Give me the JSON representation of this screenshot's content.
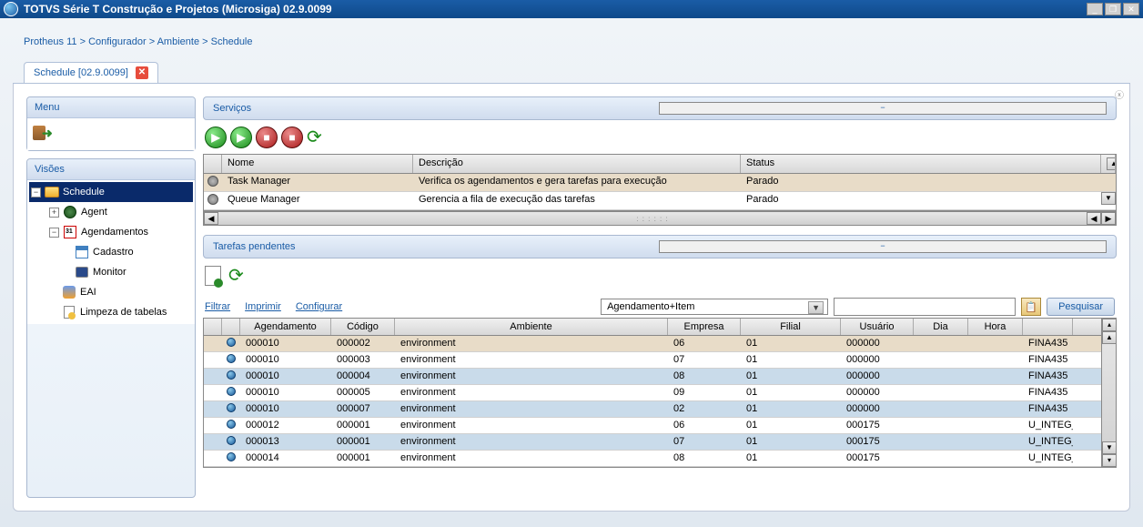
{
  "titlebar": {
    "title": "TOTVS Série T Construção e Projetos (Microsiga) 02.9.0099"
  },
  "breadcrumb": {
    "p1": "Protheus 11",
    "p2": "Configurador",
    "p3": "Ambiente",
    "p4": "Schedule"
  },
  "tab": {
    "label": "Schedule [02.9.0099]"
  },
  "menu": {
    "header": "Menu"
  },
  "visoes": {
    "header": "Visões",
    "tree": {
      "schedule": "Schedule",
      "agent": "Agent",
      "agendamentos": "Agendamentos",
      "cadastro": "Cadastro",
      "monitor": "Monitor",
      "eai": "EAI",
      "limpeza": "Limpeza de tabelas"
    }
  },
  "servicos": {
    "header": "Serviços",
    "cols": {
      "nome": "Nome",
      "desc": "Descrição",
      "status": "Status"
    },
    "rows": [
      {
        "nome": "Task Manager",
        "desc": "Verifica os agendamentos e gera tarefas para execução",
        "status": "Parado"
      },
      {
        "nome": "Queue Manager",
        "desc": "Gerencia a fila de execução das tarefas",
        "status": "Parado"
      }
    ]
  },
  "tarefas": {
    "header": "Tarefas pendentes",
    "links": {
      "filtrar": "Filtrar",
      "imprimir": "Imprimir",
      "configurar": "Configurar"
    },
    "combo": "Agendamento+Item",
    "search_btn": "Pesquisar",
    "cols": {
      "agend": "Agendamento",
      "cod": "Código",
      "amb": "Ambiente",
      "emp": "Empresa",
      "fil": "Filial",
      "usr": "Usuário",
      "dia": "Dia",
      "hora": "Hora"
    },
    "rows": [
      {
        "agend": "000010",
        "cod": "000002",
        "amb": "environment",
        "emp": "06",
        "fil": "01",
        "usr": "000000",
        "dia": "",
        "hora": "",
        "rot": "FINA435"
      },
      {
        "agend": "000010",
        "cod": "000003",
        "amb": "environment",
        "emp": "07",
        "fil": "01",
        "usr": "000000",
        "dia": "",
        "hora": "",
        "rot": "FINA435"
      },
      {
        "agend": "000010",
        "cod": "000004",
        "amb": "environment",
        "emp": "08",
        "fil": "01",
        "usr": "000000",
        "dia": "",
        "hora": "",
        "rot": "FINA435"
      },
      {
        "agend": "000010",
        "cod": "000005",
        "amb": "environment",
        "emp": "09",
        "fil": "01",
        "usr": "000000",
        "dia": "",
        "hora": "",
        "rot": "FINA435"
      },
      {
        "agend": "000010",
        "cod": "000007",
        "amb": "environment",
        "emp": "02",
        "fil": "01",
        "usr": "000000",
        "dia": "",
        "hora": "",
        "rot": "FINA435"
      },
      {
        "agend": "000012",
        "cod": "000001",
        "amb": "environment",
        "emp": "06",
        "fil": "01",
        "usr": "000175",
        "dia": "",
        "hora": "",
        "rot": "U_INTEG_"
      },
      {
        "agend": "000013",
        "cod": "000001",
        "amb": "environment",
        "emp": "07",
        "fil": "01",
        "usr": "000175",
        "dia": "",
        "hora": "",
        "rot": "U_INTEG_"
      },
      {
        "agend": "000014",
        "cod": "000001",
        "amb": "environment",
        "emp": "08",
        "fil": "01",
        "usr": "000175",
        "dia": "",
        "hora": "",
        "rot": "U_INTEG_"
      }
    ]
  }
}
